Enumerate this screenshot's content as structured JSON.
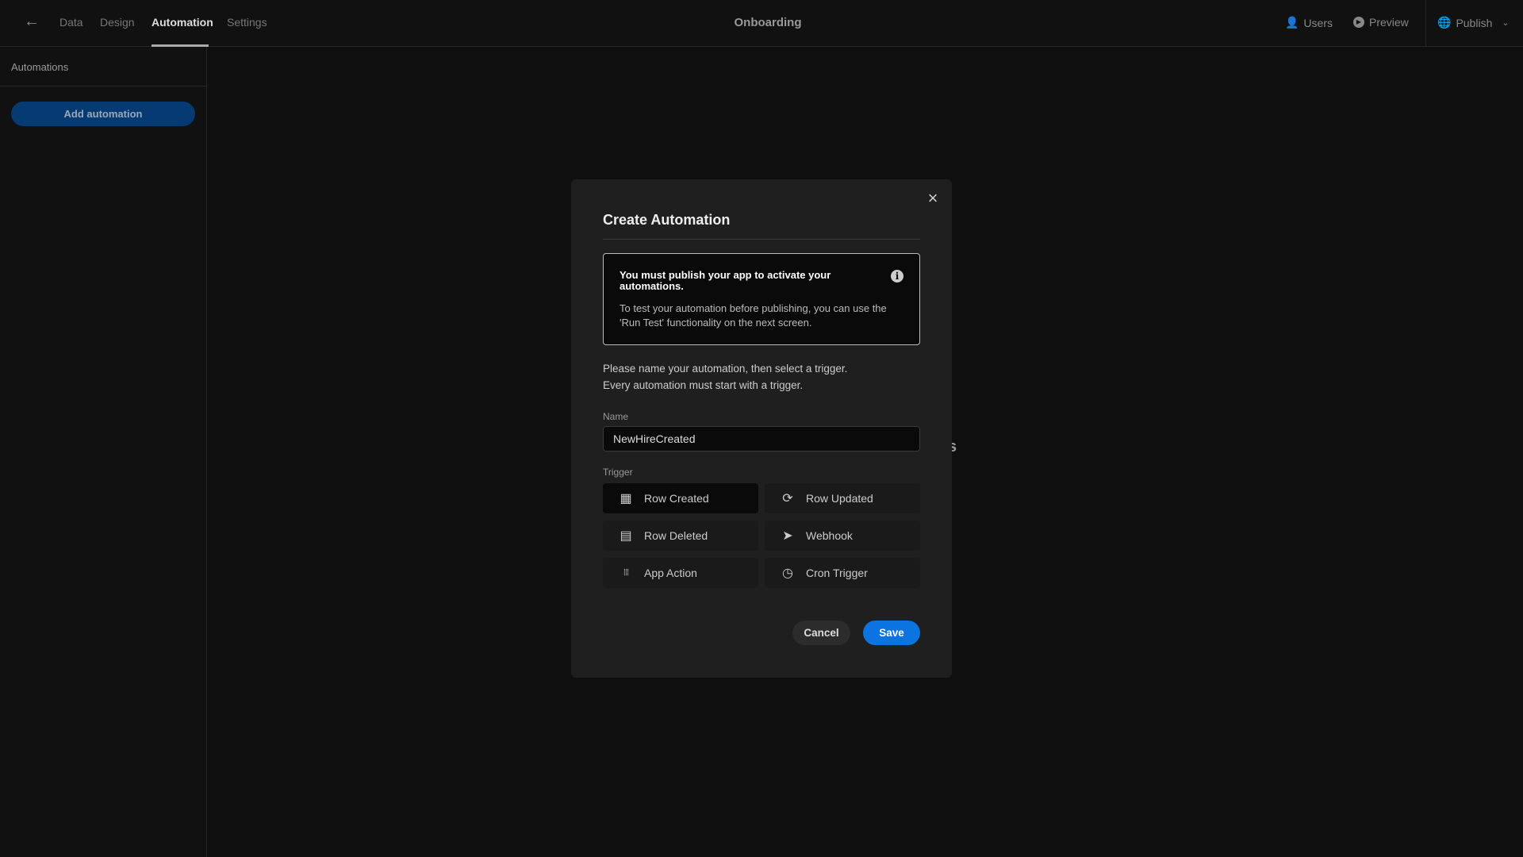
{
  "topbar": {
    "tabs": [
      {
        "label": "Data"
      },
      {
        "label": "Design"
      },
      {
        "label": "Automation",
        "active": true
      },
      {
        "label": "Settings"
      }
    ],
    "title": "Onboarding",
    "users": "Users",
    "preview": "Preview",
    "publish": "Publish"
  },
  "sidebar": {
    "header": "Automations",
    "add_button": "Add automation"
  },
  "background_text": "s",
  "modal": {
    "title": "Create Automation",
    "notice": {
      "heading": "You must publish your app to activate your automations.",
      "body": "To test your automation before publishing, you can use the 'Run Test' functionality on the next screen."
    },
    "instructions": [
      "Please name your automation, then select a trigger.",
      "Every automation must start with a trigger."
    ],
    "name_label": "Name",
    "name_value": "NewHireCreated",
    "trigger_label": "Trigger",
    "triggers": [
      {
        "label": "Row Created",
        "icon": "table-plus-icon",
        "selected": true
      },
      {
        "label": "Row Updated",
        "icon": "refresh-icon"
      },
      {
        "label": "Row Deleted",
        "icon": "table-minus-icon"
      },
      {
        "label": "Webhook",
        "icon": "send-icon"
      },
      {
        "label": "App Action",
        "icon": "grid-dots-icon"
      },
      {
        "label": "Cron Trigger",
        "icon": "clock-icon"
      }
    ],
    "cancel": "Cancel",
    "save": "Save"
  },
  "colors": {
    "accent": "#0b74e0",
    "add_button": "#053a73",
    "background": "#0f0f0f",
    "modal": "#1f1f1f"
  }
}
